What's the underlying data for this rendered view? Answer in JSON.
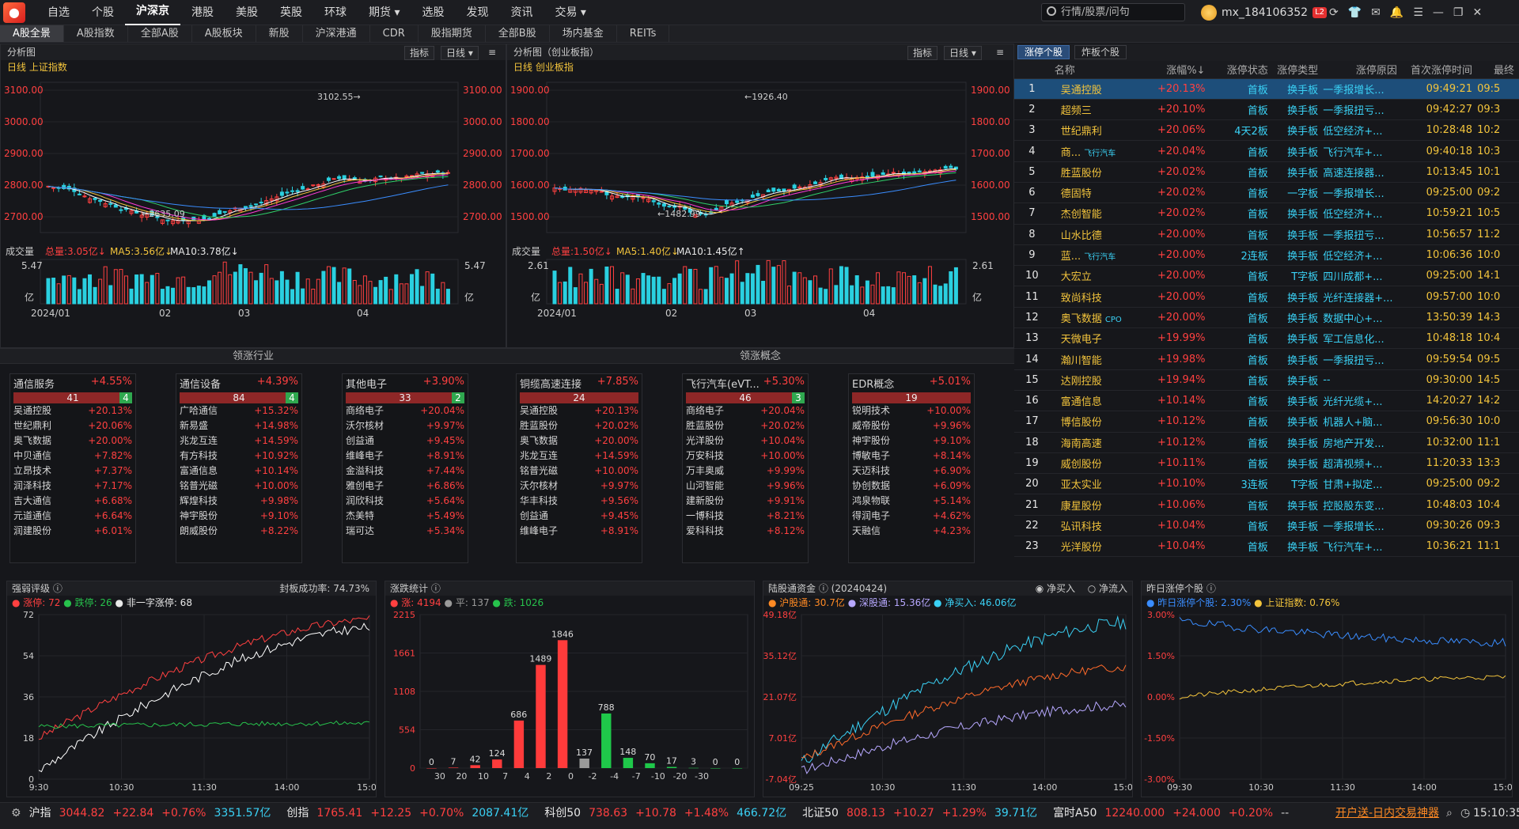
{
  "nav": {
    "logo": "同花顺",
    "items": [
      "自选",
      "个股",
      "沪深京",
      "港股",
      "美股",
      "英股",
      "环球",
      "期货 ▾",
      "选股",
      "发现",
      "资讯",
      "交易 ▾"
    ]
  },
  "search": {
    "placeholder": "行情/股票/问句"
  },
  "user": {
    "name": "mx_184106352",
    "badge": "L2"
  },
  "subtabs": [
    "A股全景",
    "A股指数",
    "全部A股",
    "A股板块",
    "新股",
    "沪深港通",
    "CDR",
    "股指期货",
    "全部B股",
    "场内基金",
    "REITs"
  ],
  "left_chart": {
    "panel_title": "分析图",
    "btn_indicator": "指标",
    "btn_period": "日线 ▾",
    "period": "日线",
    "name": "上证指数",
    "y_ticks": [
      "3100.00",
      "3000.00",
      "2900.00",
      "2800.00",
      "2700.00"
    ],
    "high_label": "3102.55→",
    "low_label": "←2635.09",
    "vol_label": "成交量",
    "vol_total": "总量:3.05亿↓",
    "vol_ma5": "MA5:3.56亿↓",
    "vol_ma10": "MA10:3.78亿↓",
    "vol_top": "5.47",
    "vol_unit": "亿",
    "x_ticks": [
      "2024/01",
      "02",
      "03",
      "04"
    ]
  },
  "mid_chart": {
    "panel_title": "分析图（创业板指）",
    "btn_indicator": "指标",
    "btn_period": "日线 ▾",
    "period": "日线",
    "name": "创业板指",
    "y_ticks": [
      "1900.00",
      "1800.00",
      "1700.00",
      "1600.00",
      "1500.00"
    ],
    "high_label": "←1926.40",
    "low_label": "←1482.99",
    "vol_label": "成交量",
    "vol_total": "总量:1.50亿↓",
    "vol_ma5": "MA5:1.40亿↓",
    "vol_ma10": "MA10:1.45亿↑",
    "vol_top": "2.61",
    "vol_unit": "亿",
    "x_ticks": [
      "2024/01",
      "02",
      "03",
      "04"
    ]
  },
  "sections": {
    "industry": "领涨行业",
    "concept": "领涨概念"
  },
  "cards": [
    {
      "name": "通信服务",
      "pct": "+4.55%",
      "up": "41",
      "down": "4",
      "rows": [
        [
          "吴通控股",
          "+20.13%"
        ],
        [
          "世纪鼎利",
          "+20.06%"
        ],
        [
          "奥飞数据",
          "+20.00%"
        ],
        [
          "中贝通信",
          "+7.82%"
        ],
        [
          "立昂技术",
          "+7.37%"
        ],
        [
          "润泽科技",
          "+7.17%"
        ],
        [
          "吉大通信",
          "+6.68%"
        ],
        [
          "元道通信",
          "+6.64%"
        ],
        [
          "润建股份",
          "+6.01%"
        ]
      ]
    },
    {
      "name": "通信设备",
      "pct": "+4.39%",
      "up": "84",
      "down": "4",
      "rows": [
        [
          "广哈通信",
          "+15.32%"
        ],
        [
          "新易盛",
          "+14.98%"
        ],
        [
          "兆龙互连",
          "+14.59%"
        ],
        [
          "有方科技",
          "+10.92%"
        ],
        [
          "富通信息",
          "+10.14%"
        ],
        [
          "铭普光磁",
          "+10.00%"
        ],
        [
          "辉煌科技",
          "+9.98%"
        ],
        [
          "神宇股份",
          "+9.10%"
        ],
        [
          "朗威股份",
          "+8.22%"
        ]
      ]
    },
    {
      "name": "其他电子",
      "pct": "+3.90%",
      "up": "33",
      "down": "2",
      "rows": [
        [
          "商络电子",
          "+20.04%"
        ],
        [
          "沃尔核材",
          "+9.97%"
        ],
        [
          "创益通",
          "+9.45%"
        ],
        [
          "维峰电子",
          "+8.91%"
        ],
        [
          "金溢科技",
          "+7.44%"
        ],
        [
          "雅创电子",
          "+6.86%"
        ],
        [
          "润欣科技",
          "+5.64%"
        ],
        [
          "杰美特",
          "+5.49%"
        ],
        [
          "瑞可达",
          "+5.34%"
        ]
      ]
    },
    {
      "name": "铜缆高速连接",
      "pct": "+7.85%",
      "up": "24",
      "down": "",
      "rows": [
        [
          "吴通控股",
          "+20.13%"
        ],
        [
          "胜蓝股份",
          "+20.02%"
        ],
        [
          "奥飞数据",
          "+20.00%"
        ],
        [
          "兆龙互连",
          "+14.59%"
        ],
        [
          "铭普光磁",
          "+10.00%"
        ],
        [
          "沃尔核材",
          "+9.97%"
        ],
        [
          "华丰科技",
          "+9.56%"
        ],
        [
          "创益通",
          "+9.45%"
        ],
        [
          "维峰电子",
          "+8.91%"
        ]
      ]
    },
    {
      "name": "飞行汽车(eVT...",
      "pct": "+5.30%",
      "up": "46",
      "down": "3",
      "rows": [
        [
          "商络电子",
          "+20.04%"
        ],
        [
          "胜蓝股份",
          "+20.02%"
        ],
        [
          "光洋股份",
          "+10.04%"
        ],
        [
          "万安科技",
          "+10.00%"
        ],
        [
          "万丰奥威",
          "+9.99%"
        ],
        [
          "山河智能",
          "+9.96%"
        ],
        [
          "建新股份",
          "+9.91%"
        ],
        [
          "一博科技",
          "+8.21%"
        ],
        [
          "爱科科技",
          "+8.12%"
        ]
      ]
    },
    {
      "name": "EDR概念",
      "pct": "+5.01%",
      "up": "19",
      "down": "",
      "rows": [
        [
          "锐明技术",
          "+10.00%"
        ],
        [
          "威帝股份",
          "+9.96%"
        ],
        [
          "神宇股份",
          "+9.10%"
        ],
        [
          "博敏电子",
          "+8.14%"
        ],
        [
          "天迈科技",
          "+6.90%"
        ],
        [
          "协创数据",
          "+6.09%"
        ],
        [
          "鸿泉物联",
          "+5.14%"
        ],
        [
          "得润电子",
          "+4.62%"
        ],
        [
          "天融信",
          "+4.23%"
        ]
      ]
    }
  ],
  "limit_table": {
    "tab_active": "涨停个股",
    "tab_other": "炸板个股",
    "headers": [
      "",
      "名称",
      "涨幅%↓",
      "涨停状态",
      "涨停类型",
      "涨停原因",
      "首次涨停时间",
      "最终"
    ],
    "rows": [
      [
        "1",
        "吴通控股",
        "",
        "+20.13%",
        "首板",
        "换手板",
        "一季报增长...",
        "09:49:21",
        "09:5"
      ],
      [
        "2",
        "超频三",
        "",
        "+20.10%",
        "首板",
        "换手板",
        "一季报扭亏...",
        "09:42:27",
        "09:3"
      ],
      [
        "3",
        "世纪鼎利",
        "",
        "+20.06%",
        "4天2板",
        "换手板",
        "低空经济+...",
        "10:28:48",
        "10:2"
      ],
      [
        "4",
        "商...",
        "飞行汽车",
        "+20.04%",
        "首板",
        "换手板",
        "飞行汽车+...",
        "09:40:18",
        "10:3"
      ],
      [
        "5",
        "胜蓝股份",
        "",
        "+20.02%",
        "首板",
        "换手板",
        "高速连接器...",
        "10:13:45",
        "10:1"
      ],
      [
        "6",
        "德固特",
        "",
        "+20.02%",
        "首板",
        "一字板",
        "一季报增长...",
        "09:25:00",
        "09:2"
      ],
      [
        "7",
        "杰创智能",
        "",
        "+20.02%",
        "首板",
        "换手板",
        "低空经济+...",
        "10:59:21",
        "10:5"
      ],
      [
        "8",
        "山水比德",
        "",
        "+20.00%",
        "首板",
        "换手板",
        "一季报扭亏...",
        "10:56:57",
        "11:2"
      ],
      [
        "9",
        "蓝...",
        "飞行汽车",
        "+20.00%",
        "2连板",
        "换手板",
        "低空经济+...",
        "10:06:36",
        "10:0"
      ],
      [
        "10",
        "大宏立",
        "",
        "+20.00%",
        "首板",
        "T字板",
        "四川成都+...",
        "09:25:00",
        "14:1"
      ],
      [
        "11",
        "致尚科技",
        "",
        "+20.00%",
        "首板",
        "换手板",
        "光纤连接器+...",
        "09:57:00",
        "10:0"
      ],
      [
        "12",
        "奥飞数据",
        "CPO",
        "+20.00%",
        "首板",
        "换手板",
        "数据中心+...",
        "13:50:39",
        "14:3"
      ],
      [
        "13",
        "天微电子",
        "",
        "+19.99%",
        "首板",
        "换手板",
        "军工信息化...",
        "10:48:18",
        "10:4"
      ],
      [
        "14",
        "瀚川智能",
        "",
        "+19.98%",
        "首板",
        "换手板",
        "一季报扭亏...",
        "09:59:54",
        "09:5"
      ],
      [
        "15",
        "达刚控股",
        "",
        "+19.94%",
        "首板",
        "换手板",
        "--",
        "09:30:00",
        "14:5"
      ],
      [
        "16",
        "富通信息",
        "",
        "+10.14%",
        "首板",
        "换手板",
        "光纤光缆+...",
        "14:20:27",
        "14:2"
      ],
      [
        "17",
        "博信股份",
        "",
        "+10.12%",
        "首板",
        "换手板",
        "机器人+脑...",
        "09:56:30",
        "10:0"
      ],
      [
        "18",
        "海南高速",
        "",
        "+10.12%",
        "首板",
        "换手板",
        "房地产开发...",
        "10:32:00",
        "11:1"
      ],
      [
        "19",
        "威创股份",
        "",
        "+10.11%",
        "首板",
        "换手板",
        "超清视频+...",
        "11:20:33",
        "13:3"
      ],
      [
        "20",
        "亚太实业",
        "",
        "+10.10%",
        "3连板",
        "T字板",
        "甘肃+拟定...",
        "09:25:00",
        "09:2"
      ],
      [
        "21",
        "康星股份",
        "",
        "+10.06%",
        "首板",
        "换手板",
        "控股股东变...",
        "10:48:03",
        "10:4"
      ],
      [
        "22",
        "弘讯科技",
        "",
        "+10.04%",
        "首板",
        "换手板",
        "一季报增长...",
        "09:30:26",
        "09:3"
      ],
      [
        "23",
        "光洋股份",
        "",
        "+10.04%",
        "首板",
        "换手板",
        "飞行汽车+...",
        "10:36:21",
        "11:1"
      ]
    ]
  },
  "panel_strength": {
    "title": "强弱评级",
    "rate_label": "封板成功率: 74.73%",
    "legend": [
      "涨停: 72",
      "跌停: 26",
      "非一字涨停: 68"
    ],
    "y_ticks": [
      "72",
      "54",
      "36",
      "18",
      "0"
    ],
    "x_ticks": [
      "9:30",
      "10:30",
      "11:30",
      "14:00",
      "15:00"
    ]
  },
  "panel_updown": {
    "title": "涨跌统计",
    "legend": [
      "涨: 4194",
      "平: 137",
      "跌: 1026"
    ],
    "y_ticks": [
      "2215",
      "1661",
      "1108",
      "554",
      "0"
    ],
    "chart_data": {
      "type": "bar",
      "categories": [
        "30",
        "20",
        "10",
        "7",
        "4",
        "2",
        "0",
        "-2",
        "-4",
        "-7",
        "-10",
        "-20",
        "-30"
      ],
      "values": [
        0,
        7,
        42,
        124,
        686,
        1489,
        1846,
        137,
        788,
        148,
        70,
        17,
        3,
        0,
        0
      ],
      "ylim": [
        0,
        2215
      ]
    },
    "bars": [
      {
        "v": 0,
        "c": "#ff3b3b",
        "l": "0"
      },
      {
        "v": 7,
        "c": "#ff3b3b",
        "l": "7"
      },
      {
        "v": 42,
        "c": "#ff3b3b",
        "l": "42"
      },
      {
        "v": 124,
        "c": "#ff3b3b",
        "l": "124"
      },
      {
        "v": 686,
        "c": "#ff3b3b",
        "l": "686"
      },
      {
        "v": 1489,
        "c": "#ff3b3b",
        "l": "1489"
      },
      {
        "v": 1846,
        "c": "#ff3b3b",
        "l": "1846"
      },
      {
        "v": 137,
        "c": "#9a9a9a",
        "l": "137"
      },
      {
        "v": 788,
        "c": "#1fc84a",
        "l": "788"
      },
      {
        "v": 148,
        "c": "#1fc84a",
        "l": "148"
      },
      {
        "v": 70,
        "c": "#1fc84a",
        "l": "70"
      },
      {
        "v": 17,
        "c": "#1fc84a",
        "l": "17"
      },
      {
        "v": 3,
        "c": "#1fc84a",
        "l": "3"
      },
      {
        "v": 0,
        "c": "#1fc84a",
        "l": "0"
      },
      {
        "v": 0,
        "c": "#1fc84a",
        "l": "0"
      }
    ],
    "x_labels": [
      "30",
      "20",
      "10",
      "7",
      "4",
      "2",
      "0",
      "-2",
      "-4",
      "-7",
      "-10",
      "-20",
      "-30"
    ]
  },
  "panel_flow": {
    "title": "陆股通资金",
    "date": "(20240424)",
    "opt1": "净买入",
    "opt2": "净流入",
    "legend": [
      "沪股通: 30.7亿",
      "深股通: 15.36亿",
      "净买入: 46.06亿"
    ],
    "y_ticks": [
      "49.18亿",
      "35.12亿",
      "21.07亿",
      "7.01亿",
      "-7.04亿"
    ],
    "x_ticks": [
      "09:25",
      "10:30",
      "11:30",
      "14:00",
      "15:00"
    ]
  },
  "panel_yest": {
    "title": "昨日涨停个股",
    "legend": [
      "昨日涨停个股: 2.30%",
      "上证指数: 0.76%"
    ],
    "y_ticks": [
      "3.00%",
      "1.50%",
      "0.00%",
      "-1.50%",
      "-3.00%"
    ],
    "x_ticks": [
      "09:30",
      "10:30",
      "11:30",
      "14:00",
      "15:00"
    ]
  },
  "footer": {
    "sh": [
      "沪指",
      "3044.82",
      "+22.84",
      "+0.76%",
      "3351.57亿"
    ],
    "cy": [
      "创指",
      "1765.41",
      "+12.25",
      "+0.70%",
      "2087.41亿"
    ],
    "kc": [
      "科创50",
      "738.63",
      "+10.78",
      "+1.48%",
      "466.72亿"
    ],
    "bz": [
      "北证50",
      "808.13",
      "+10.27",
      "+1.29%",
      "39.71亿"
    ],
    "a50": [
      "富时A50",
      "12240.000",
      "+24.000",
      "+0.20%",
      "--"
    ],
    "promo": "开户送-日内交易神器",
    "time": "15:10:35"
  }
}
